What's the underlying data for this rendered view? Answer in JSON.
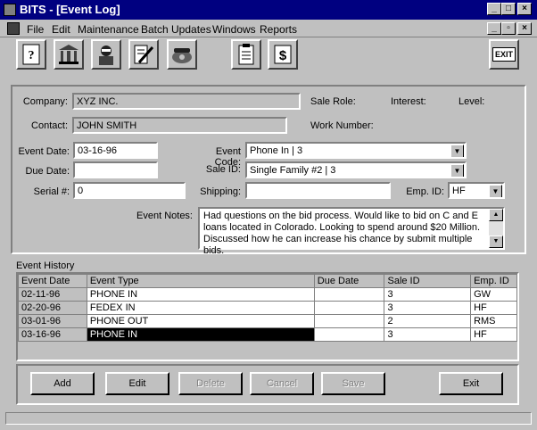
{
  "window": {
    "title": "BITS - [Event Log]"
  },
  "menu": [
    "File",
    "Edit",
    "Maintenance",
    "Batch Updates",
    "Windows",
    "Reports"
  ],
  "toolbar": {
    "exit_label": "EXIT"
  },
  "form": {
    "company_label": "Company:",
    "company_value": "XYZ INC.",
    "contact_label": "Contact:",
    "contact_value": "JOHN SMITH",
    "sale_role_label": "Sale Role:",
    "interest_label": "Interest:",
    "level_label": "Level:",
    "work_number_label": "Work Number:",
    "event_date_label": "Event Date:",
    "event_date_value": "03-16-96",
    "event_code_label": "Event Code:",
    "event_code_value": "Phone In | 3",
    "due_date_label": "Due Date:",
    "due_date_value": "",
    "sale_id_label": "Sale ID:",
    "sale_id_value": "Single Family #2 | 3",
    "serial_label": "Serial #:",
    "serial_value": "0",
    "shipping_label": "Shipping:",
    "shipping_value": "",
    "emp_id_label": "Emp. ID:",
    "emp_id_value": "HF",
    "notes_label": "Event Notes:",
    "notes_value": "Had questions on the bid process.  Would like to bid on C and E loans located in Colorado. Looking to spend around $20 Million.  Discussed  how he can increase his chance by submit multiple bids."
  },
  "history": {
    "title": "Event History",
    "columns": [
      "Event Date",
      "Event Type",
      "Due Date",
      "Sale ID",
      "Emp. ID"
    ],
    "rows": [
      [
        "02-11-96",
        "PHONE IN",
        "",
        "3",
        "GW"
      ],
      [
        "02-20-96",
        "FEDEX IN",
        "",
        "3",
        "HF"
      ],
      [
        "03-01-96",
        "PHONE OUT",
        "",
        "2",
        "RMS"
      ],
      [
        "03-16-96",
        "PHONE IN",
        "",
        "3",
        "HF"
      ]
    ]
  },
  "buttons": {
    "add": "Add",
    "edit": "Edit",
    "delete": "Delete",
    "cancel": "Cancel",
    "save": "Save",
    "exit": "Exit"
  }
}
